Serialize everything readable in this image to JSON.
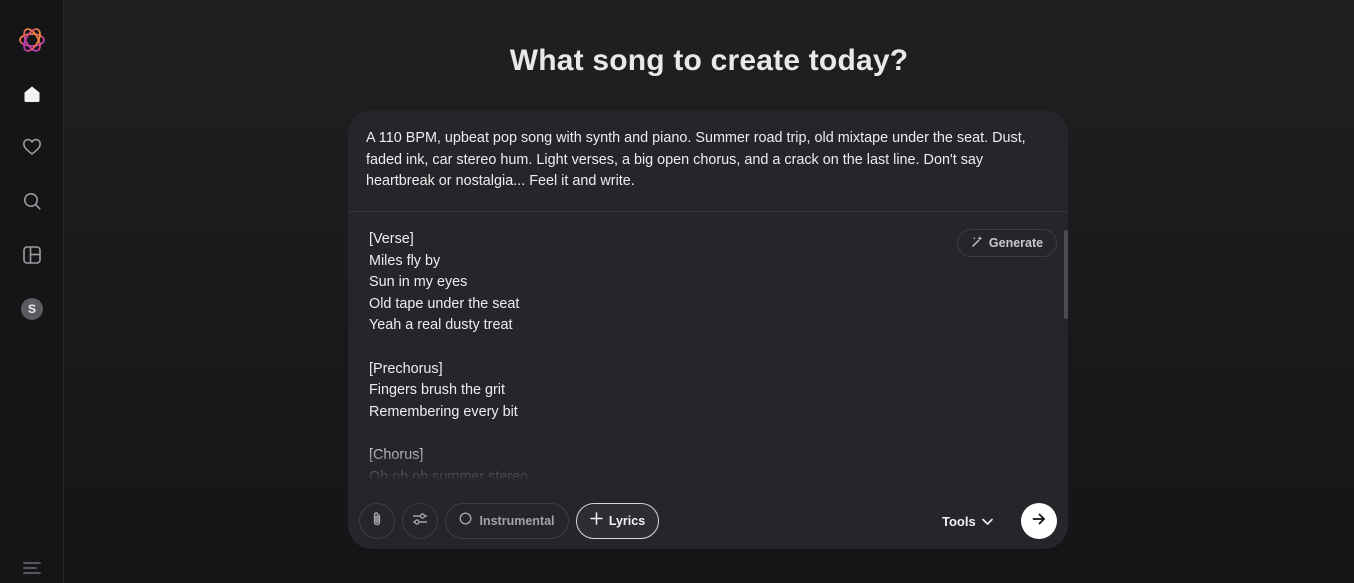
{
  "page": {
    "title": "What song to create today?"
  },
  "sidebar": {
    "items": [
      {
        "name": "logo",
        "icon": "logo-icon"
      },
      {
        "name": "home",
        "icon": "home-icon"
      },
      {
        "name": "favorites",
        "icon": "heart-icon"
      },
      {
        "name": "search",
        "icon": "search-icon"
      },
      {
        "name": "library",
        "icon": "layout-icon"
      },
      {
        "name": "profile",
        "avatar_letter": "S"
      },
      {
        "name": "menu",
        "icon": "menu-icon"
      }
    ]
  },
  "composer": {
    "prompt": "A 110 BPM, upbeat pop song with synth and piano. Summer road trip, old mixtape under the seat. Dust, faded ink, car stereo hum. Light verses, a big open chorus, and a crack on the last line. Don't say heartbreak or nostalgia... Feel it and write.",
    "lyrics": "[Verse]\nMiles fly by\nSun in my eyes\nOld tape under the seat\nYeah a real dusty treat\n\n[Prechorus]\nFingers brush the grit\nRemembering every bit\n\n[Chorus]\nOh oh oh summer stereo",
    "generate_label": "Generate",
    "toolbar": {
      "attach_icon": "paperclip-icon",
      "settings_icon": "sliders-icon",
      "instrumental_label": "Instrumental",
      "lyrics_label": "Lyrics",
      "tools_label": "Tools",
      "send_icon": "arrow-right-icon"
    }
  },
  "colors": {
    "background": "#18191b",
    "card": "#24262a",
    "accent_logo": [
      "#f5a623",
      "#e0457b",
      "#9b3fd9"
    ]
  }
}
